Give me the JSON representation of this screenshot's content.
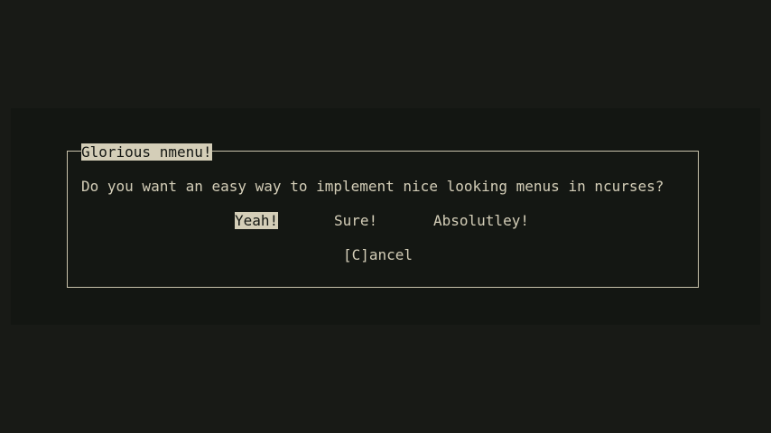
{
  "dialog": {
    "title": "Glorious nmenu!",
    "question": "Do you want an easy way to implement nice looking menus in ncurses?",
    "options": [
      {
        "label": "Yeah!",
        "selected": true
      },
      {
        "label": "Sure!",
        "selected": false
      },
      {
        "label": "Absolutley!",
        "selected": false
      }
    ],
    "cancel_label": "[C]ancel"
  },
  "colors": {
    "background": "#181a16",
    "foreground": "#d4ceb8",
    "highlight_bg": "#d4ceb8",
    "highlight_fg": "#141713"
  }
}
